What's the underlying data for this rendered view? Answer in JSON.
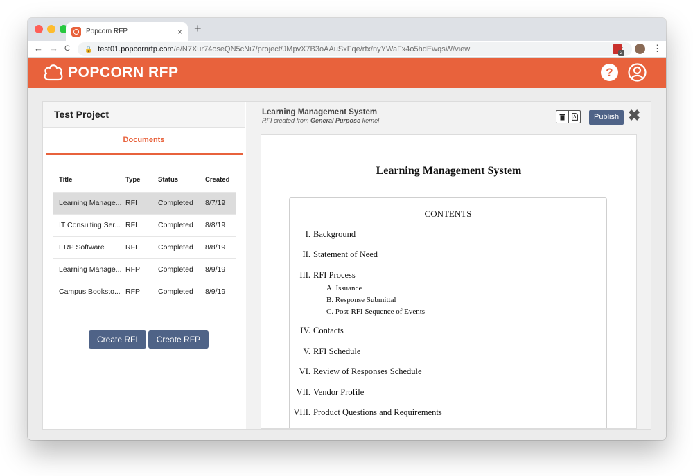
{
  "browser": {
    "tab_title": "Popcorn RFP",
    "tab_close": "×",
    "new_tab": "+",
    "back": "←",
    "forward": "→",
    "reload": "C",
    "url_host": "test01.popcornrfp.com",
    "url_path": "/e/N7Xur74oseQN5cNi7/project/JMpvX7B3oAAuSxFqe/rfx/nyYWaFx4o5hdEwqsW/view",
    "extension_badge": "2"
  },
  "header": {
    "brand": "POPCORN RFP",
    "accent_color": "#e8623c",
    "help_label": "?"
  },
  "project": {
    "title": "Test Project",
    "tab_label": "Documents",
    "columns": [
      "Title",
      "Type",
      "Status",
      "Created"
    ],
    "rows": [
      {
        "title": "Learning Manage...",
        "type": "RFI",
        "status": "Completed",
        "created": "8/7/19"
      },
      {
        "title": "IT Consulting Ser...",
        "type": "RFI",
        "status": "Completed",
        "created": "8/8/19"
      },
      {
        "title": "ERP Software",
        "type": "RFI",
        "status": "Completed",
        "created": "8/8/19"
      },
      {
        "title": "Learning Manage...",
        "type": "RFP",
        "status": "Completed",
        "created": "8/9/19"
      },
      {
        "title": "Campus Booksto...",
        "type": "RFP",
        "status": "Completed",
        "created": "8/9/19"
      }
    ],
    "create_rfi": "Create RFI",
    "create_rfp": "Create RFP",
    "button_color": "#4f6387"
  },
  "document": {
    "title": "Learning Management System",
    "subtitle_prefix": "RFI created from ",
    "subtitle_kernel": "General Purpose",
    "subtitle_suffix": " kernel",
    "publish_label": "Publish",
    "close_label": "✖",
    "heading": "Learning Management System",
    "contents_title": "CONTENTS",
    "toc": [
      {
        "num": "I.",
        "label": "Background"
      },
      {
        "num": "II.",
        "label": "Statement of Need"
      },
      {
        "num": "III.",
        "label": "RFI Process",
        "subs": [
          {
            "num": "A.",
            "label": "Issuance"
          },
          {
            "num": "B.",
            "label": "Response Submittal"
          },
          {
            "num": "C.",
            "label": "Post-RFI Sequence of Events"
          }
        ]
      },
      {
        "num": "IV.",
        "label": "Contacts"
      },
      {
        "num": "V.",
        "label": "RFI Schedule"
      },
      {
        "num": "VI.",
        "label": "Review of Responses Schedule"
      },
      {
        "num": "VII.",
        "label": "Vendor Profile"
      },
      {
        "num": "VIII.",
        "label": "Product Questions and Requirements"
      }
    ]
  }
}
